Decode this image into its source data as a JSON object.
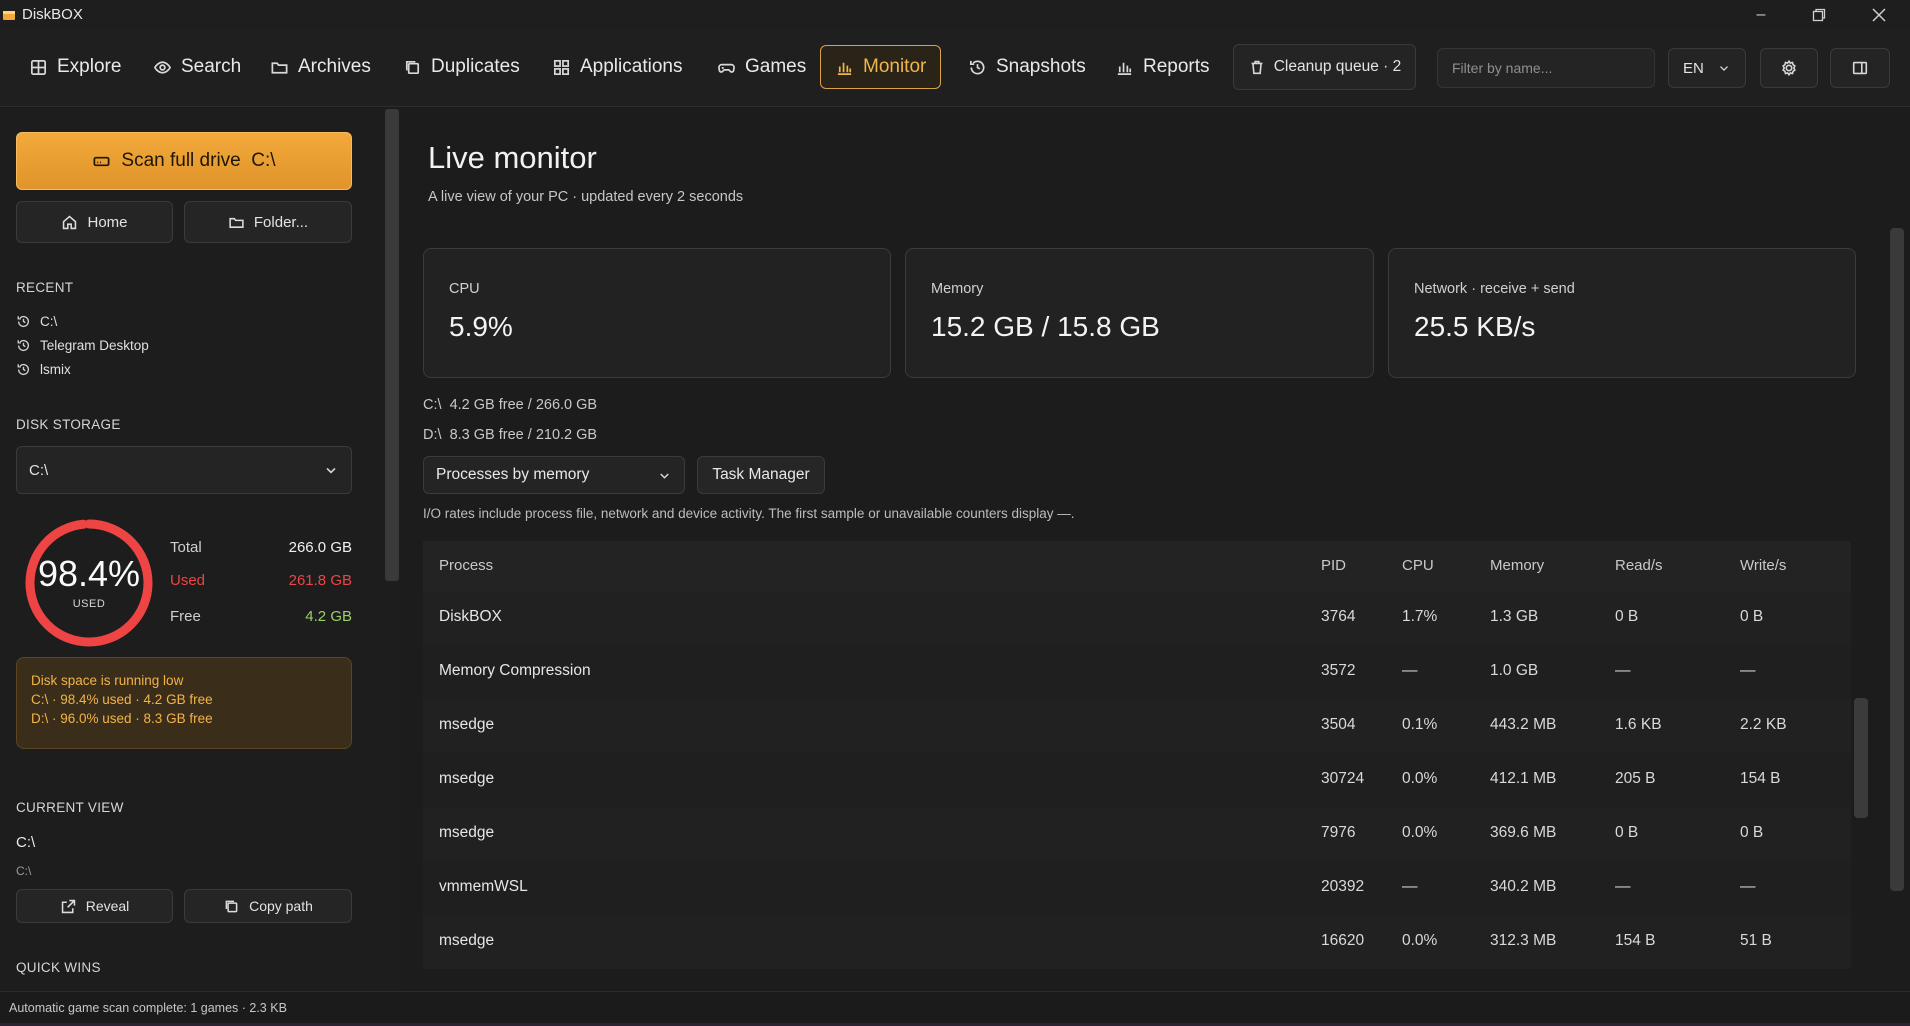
{
  "app": {
    "title": "DiskBOX"
  },
  "nav": {
    "explore": "Explore",
    "search": "Search",
    "archives": "Archives",
    "duplicates": "Duplicates",
    "applications": "Applications",
    "games": "Games",
    "monitor": "Monitor",
    "snapshots": "Snapshots",
    "reports": "Reports",
    "cleanup_queue": "Cleanup queue · 2",
    "filter_placeholder": "Filter by name...",
    "language": "EN"
  },
  "colors": {
    "accent": "#f0b54c",
    "danger": "#ef4444",
    "success": "#9bd069",
    "warning_text": "#f3b347"
  },
  "sidebar": {
    "scan_label": "Scan full drive  C:\\",
    "home": "Home",
    "folder": "Folder...",
    "recent_label": "RECENT",
    "recent": [
      "C:\\",
      "Telegram Desktop",
      "lsmix"
    ],
    "disk_storage_label": "DISK STORAGE",
    "drive_selected": "C:\\",
    "usage_pct": "98.4%",
    "usage_fraction": 0.984,
    "used_caption": "USED",
    "total_label": "Total",
    "total_value": "266.0 GB",
    "used_label": "Used",
    "used_value": "261.8 GB",
    "free_label": "Free",
    "free_value": "4.2 GB",
    "warning": {
      "title": "Disk space is running low",
      "line1": "C:\\ · 98.4% used · 4.2 GB free",
      "line2": "D:\\ · 96.0% used · 8.3 GB free"
    },
    "current_view_label": "CURRENT VIEW",
    "current_path": "C:\\",
    "current_sub": "C:\\",
    "reveal": "Reveal",
    "copy_path": "Copy path",
    "quick_wins_label": "QUICK WINS"
  },
  "main": {
    "title": "Live monitor",
    "subtitle": "A live view of your PC · updated every 2 seconds",
    "cards": [
      {
        "label": "CPU",
        "value": "5.9%"
      },
      {
        "label": "Memory",
        "value": "15.2 GB / 15.8 GB"
      },
      {
        "label": "Network · receive + send",
        "value": "25.5 KB/s"
      }
    ],
    "drive_c": "C:\\  4.2 GB free / 266.0 GB",
    "drive_d": "D:\\  8.3 GB free / 210.2 GB",
    "sort_select": "Processes by memory",
    "task_manager": "Task Manager",
    "note": "I/O rates include process file, network and device activity. The first sample or unavailable counters display —.",
    "columns": [
      "Process",
      "PID",
      "CPU",
      "Memory",
      "Read/s",
      "Write/s"
    ],
    "rows": [
      [
        "DiskBOX",
        "3764",
        "1.7%",
        "1.3 GB",
        "0 B",
        "0 B"
      ],
      [
        "Memory Compression",
        "3572",
        "—",
        "1.0 GB",
        "—",
        "—"
      ],
      [
        "msedge",
        "3504",
        "0.1%",
        "443.2 MB",
        "1.6 KB",
        "2.2 KB"
      ],
      [
        "msedge",
        "30724",
        "0.0%",
        "412.1 MB",
        "205 B",
        "154 B"
      ],
      [
        "msedge",
        "7976",
        "0.0%",
        "369.6 MB",
        "0 B",
        "0 B"
      ],
      [
        "vmmemWSL",
        "20392",
        "—",
        "340.2 MB",
        "—",
        "—"
      ],
      [
        "msedge",
        "16620",
        "0.0%",
        "312.3 MB",
        "154 B",
        "51 B"
      ]
    ]
  },
  "status": {
    "text": "Automatic game scan complete: 1 games · 2.3 KB"
  }
}
